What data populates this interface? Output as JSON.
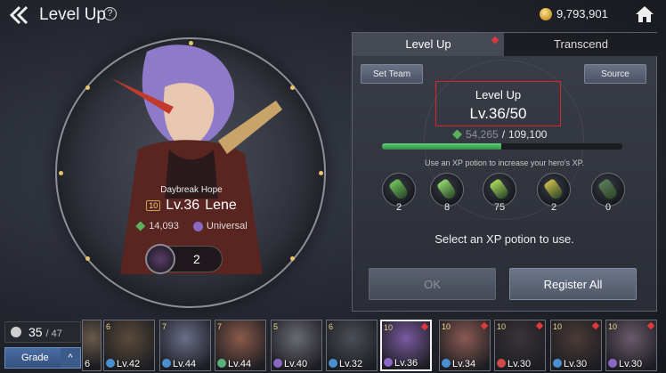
{
  "header": {
    "title": "Level Up",
    "help": "?",
    "gold": "9,793,901"
  },
  "hero": {
    "epithet": "Daybreak Hope",
    "stars": "10",
    "level": "Lv.36",
    "name": "Lene",
    "combat_power": "14,093",
    "class": "Universal",
    "awakening": "2"
  },
  "panel": {
    "tabs": [
      "Level Up",
      "Transcend"
    ],
    "set_team": "Set Team",
    "source": "Source",
    "level_title": "Level Up",
    "level_value": "Lv.36/50",
    "xp_current": "54,265",
    "xp_sep": "/",
    "xp_max": "109,100",
    "xp_progress": 0.497,
    "hint": "Use an XP potion to increase your hero's XP.",
    "potions": [
      {
        "icon": "small-xp-potion-icon",
        "count": "2",
        "color": "#6fbf5a"
      },
      {
        "icon": "medium-xp-potion-icon",
        "count": "8",
        "color": "#8fd46a"
      },
      {
        "icon": "large-xp-potion-icon",
        "count": "75",
        "color": "#a6d65a"
      },
      {
        "icon": "special-xp-potion-icon",
        "count": "2",
        "color": "#c9b84a"
      },
      {
        "icon": "elite-xp-potion-icon",
        "count": "0",
        "color": "#5a7a5a"
      }
    ],
    "select_hint": "Select an XP potion to use.",
    "ok": "OK",
    "register_all": "Register All"
  },
  "roster": {
    "count": "35",
    "total": "/ 47",
    "grade": "Grade",
    "grade_arrow": "^",
    "cards": [
      {
        "stars": "",
        "level": "6",
        "class_color": "#4a8fd0",
        "color": "#6a5a4a",
        "alert": false
      },
      {
        "stars": "6",
        "level": "Lv.42",
        "class_color": "#4a8fd0",
        "color": "#5a4a3a",
        "alert": false
      },
      {
        "stars": "7",
        "level": "Lv.44",
        "class_color": "#4a8fd0",
        "color": "#6a6e8a",
        "alert": false
      },
      {
        "stars": "7",
        "level": "Lv.44",
        "class_color": "#5ab07a",
        "color": "#8a5a4a",
        "alert": false
      },
      {
        "stars": "5",
        "level": "Lv.40",
        "class_color": "#8a68c4",
        "color": "#6a6a72",
        "alert": false
      },
      {
        "stars": "6",
        "level": "Lv.32",
        "class_color": "#4a8fd0",
        "color": "#4a4e56",
        "alert": false
      },
      {
        "stars": "10",
        "level": "Lv.36",
        "class_color": "#8a68c4",
        "color": "#7a5aa0",
        "alert": true
      },
      {
        "stars": "10",
        "level": "Lv.34",
        "class_color": "#4a8fd0",
        "color": "#8a5a52",
        "alert": true
      },
      {
        "stars": "10",
        "level": "Lv.30",
        "class_color": "#d04a4a",
        "color": "#3a3438",
        "alert": true
      },
      {
        "stars": "10",
        "level": "Lv.30",
        "class_color": "#4a8fd0",
        "color": "#4a3a36",
        "alert": true
      },
      {
        "stars": "10",
        "level": "Lv.30",
        "class_color": "#8a68c4",
        "color": "#6a5a6a",
        "alert": true
      }
    ]
  }
}
